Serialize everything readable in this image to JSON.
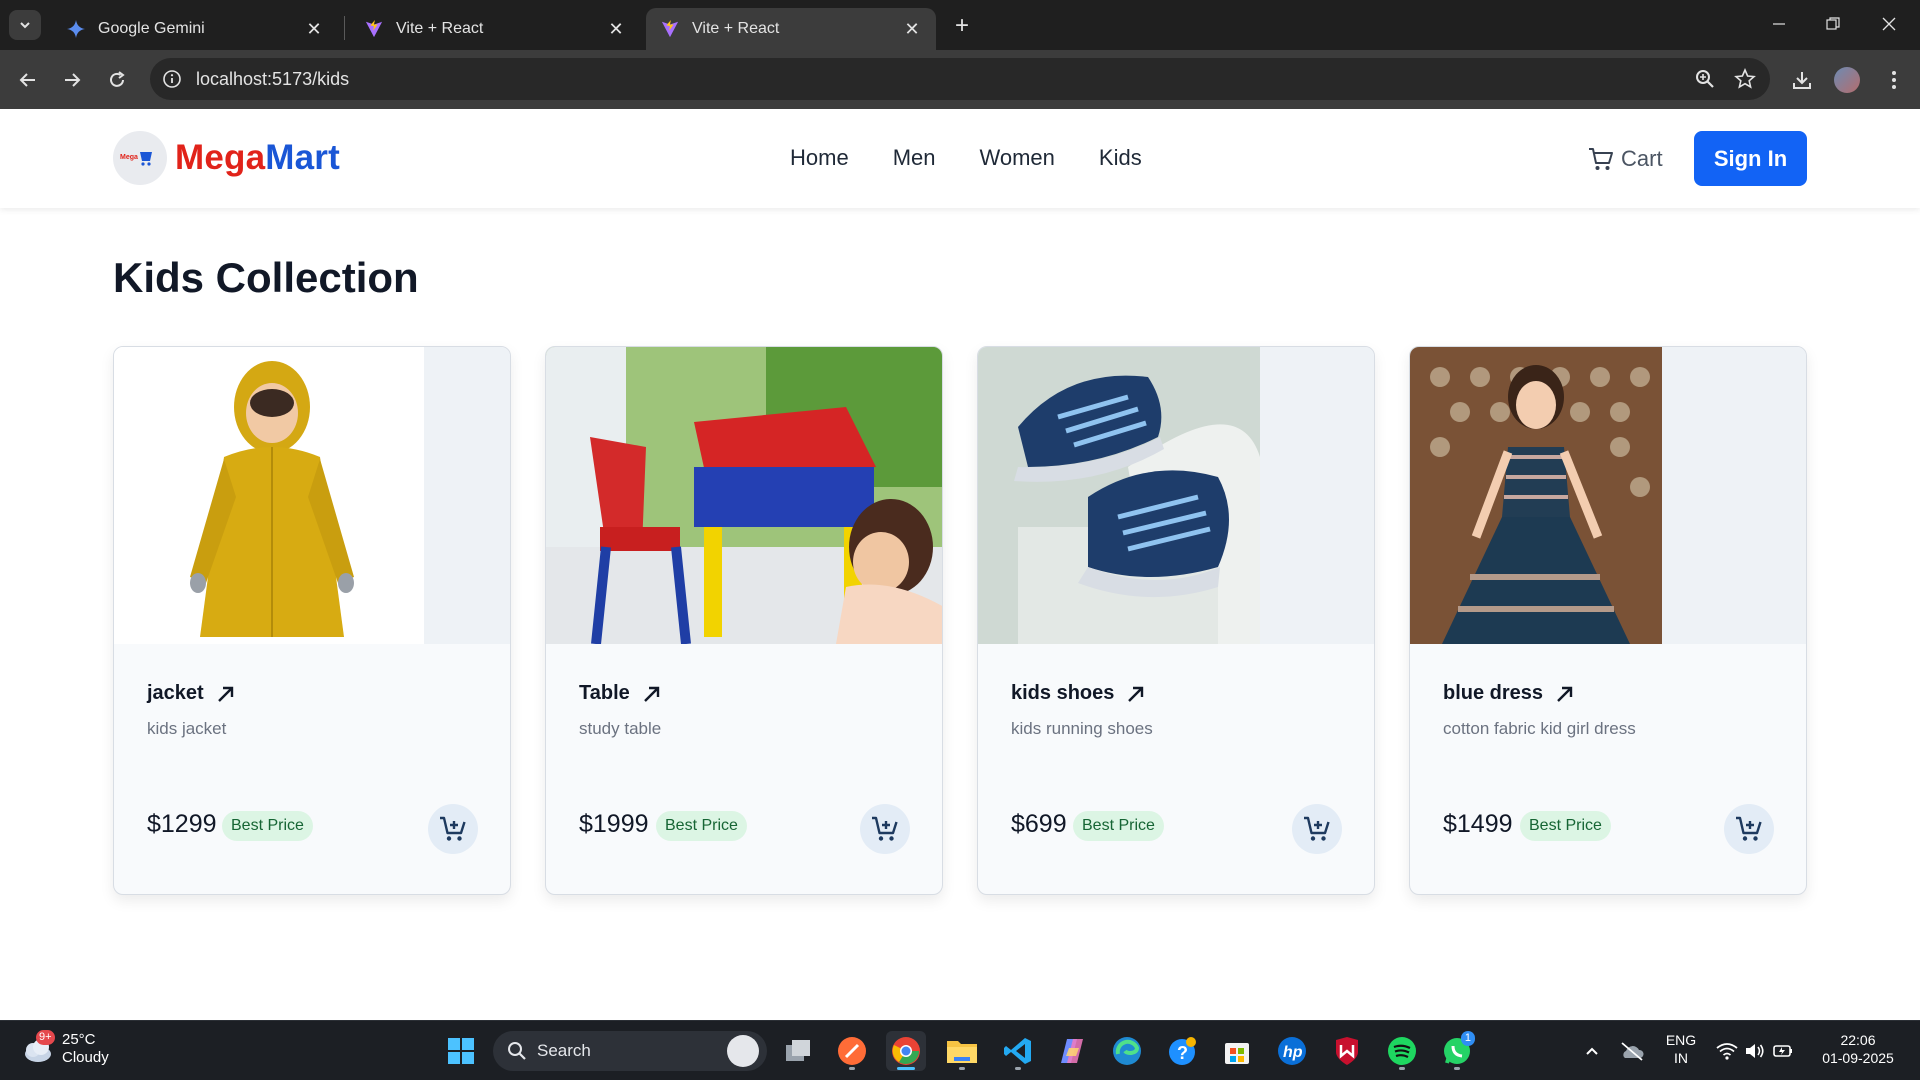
{
  "browser": {
    "tabs": [
      {
        "title": "Google Gemini",
        "active": false
      },
      {
        "title": "Vite + React",
        "active": false
      },
      {
        "title": "Vite + React",
        "active": true
      }
    ],
    "url": "localhost:5173/kids"
  },
  "header": {
    "brand_part1": "Mega",
    "brand_part2": "Mart",
    "nav": [
      "Home",
      "Men",
      "Women",
      "Kids"
    ],
    "cart_label": "Cart",
    "signin_label": "Sign In"
  },
  "page": {
    "title": "Kids Collection"
  },
  "products": [
    {
      "name": "jacket",
      "description": "kids jacket",
      "price": "$1299",
      "badge": "Best Price"
    },
    {
      "name": "Table",
      "description": "study table",
      "price": "$1999",
      "badge": "Best Price"
    },
    {
      "name": "kids shoes",
      "description": "kids running shoes",
      "price": "$699",
      "badge": "Best Price"
    },
    {
      "name": "blue dress",
      "description": "cotton fabric kid girl dress",
      "price": "$1499",
      "badge": "Best Price"
    }
  ],
  "taskbar": {
    "weather_temp": "25°C",
    "weather_cond": "Cloudy",
    "weather_badge": "9+",
    "search_label": "Search",
    "lang_line1": "ENG",
    "lang_line2": "IN",
    "time": "22:06",
    "date": "01-09-2025",
    "whatsapp_badge": "1"
  },
  "colors": {
    "brand_red": "#e1231a",
    "brand_blue": "#1a56d6",
    "signin_bg": "#1263f5",
    "badge_bg": "#dcf5e4",
    "badge_text": "#166534"
  }
}
